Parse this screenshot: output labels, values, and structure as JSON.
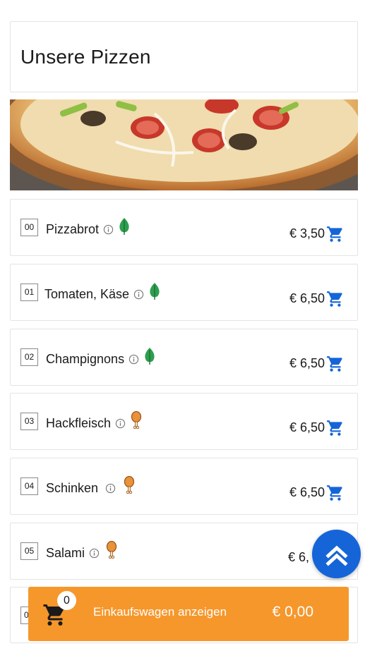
{
  "header": {
    "title": "Unsere Pizzen"
  },
  "items": [
    {
      "num": "00",
      "name": "Pizzabrot",
      "price": "€ 3,50",
      "diet_icon": "leaf-icon"
    },
    {
      "num": "01",
      "name": "Tomaten, Käse",
      "price": "€ 6,50",
      "diet_icon": "leaf-icon"
    },
    {
      "num": "02",
      "name": "Champignons",
      "price": "€ 6,50",
      "diet_icon": "leaf-icon"
    },
    {
      "num": "03",
      "name": "Hackfleisch",
      "price": "€ 6,50",
      "diet_icon": "meat-icon"
    },
    {
      "num": "04",
      "name": "Schinken",
      "price": "€ 6,50",
      "diet_icon": "meat-icon"
    },
    {
      "num": "05",
      "name": "Salami",
      "price": "€ 6,",
      "diet_icon": "meat-icon"
    },
    {
      "num": "0"
    }
  ],
  "cart": {
    "count": "0",
    "label": "Einkaufswagen anzeigen",
    "total": "€ 0,00"
  },
  "colors": {
    "accent_blue": "#1565d8",
    "cart_orange": "#f6972b",
    "leaf_green": "#2e9e4f",
    "meat_orange": "#e8923a"
  }
}
